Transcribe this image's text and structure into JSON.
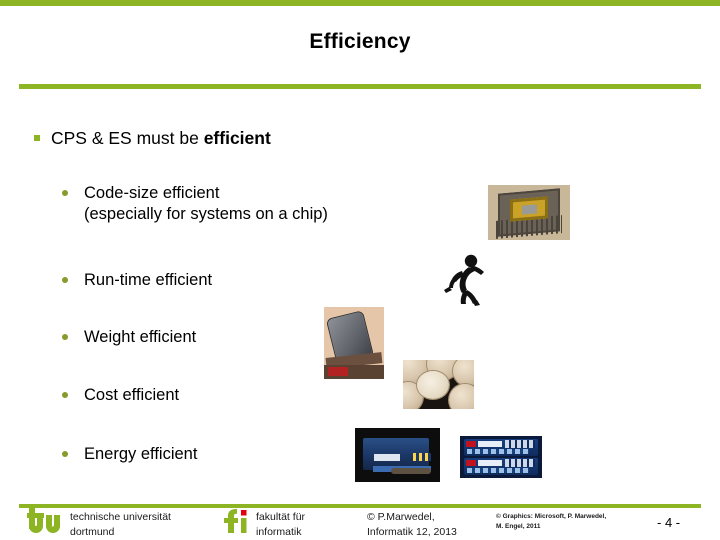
{
  "slide": {
    "title": "Efficiency",
    "accent_color": "#8cb423",
    "bullet_square_color": "#8cb423",
    "bullet_dot_color": "#8a9a2a"
  },
  "content": {
    "level1": {
      "text_plain": "CPS & ES must be efficient",
      "text_normal": "CPS & ES must be ",
      "text_bold": "efficient"
    },
    "level2": [
      {
        "line1": "Code-size efficient",
        "line2": "(especially for systems on a chip)"
      },
      {
        "line1": "Run-time efficient",
        "line2": ""
      },
      {
        "line1": "Weight efficient",
        "line2": ""
      },
      {
        "line1": "Cost efficient",
        "line2": ""
      },
      {
        "line1": "Energy efficient",
        "line2": ""
      }
    ]
  },
  "images": [
    {
      "name": "microchip-photo",
      "alt": "Ceramic CPU chip package with gold center"
    },
    {
      "name": "running-figure",
      "alt": "Black running stick figure silhouette"
    },
    {
      "name": "phone-on-scale-photo",
      "alt": "Mobile phone resting on a weighing scale"
    },
    {
      "name": "coins-photo",
      "alt": "Stack of coins on dark background"
    },
    {
      "name": "battery-charger-photo",
      "alt": "Blue VARTA battery charger"
    },
    {
      "name": "rechargeable-batteries-photo",
      "alt": "Two blue rechargeable battery cells"
    }
  ],
  "footer": {
    "tu_line1": "technische universität",
    "tu_line2": "dortmund",
    "tu_logo_text": "tu",
    "fi_logo_text": "fi",
    "fi_line1": "fakultät für",
    "fi_line2": "informatik",
    "copyright_line1": "© P.Marwedel,",
    "copyright_line2": "Informatik 12,  2013",
    "graphics_line1": "© Graphics: Microsoft, P. Marwedel,",
    "graphics_line2": "M. Engel, 2011",
    "page_number": "- 4 -",
    "tu_green": "#8cb423",
    "fi_red": "#e3000f"
  }
}
